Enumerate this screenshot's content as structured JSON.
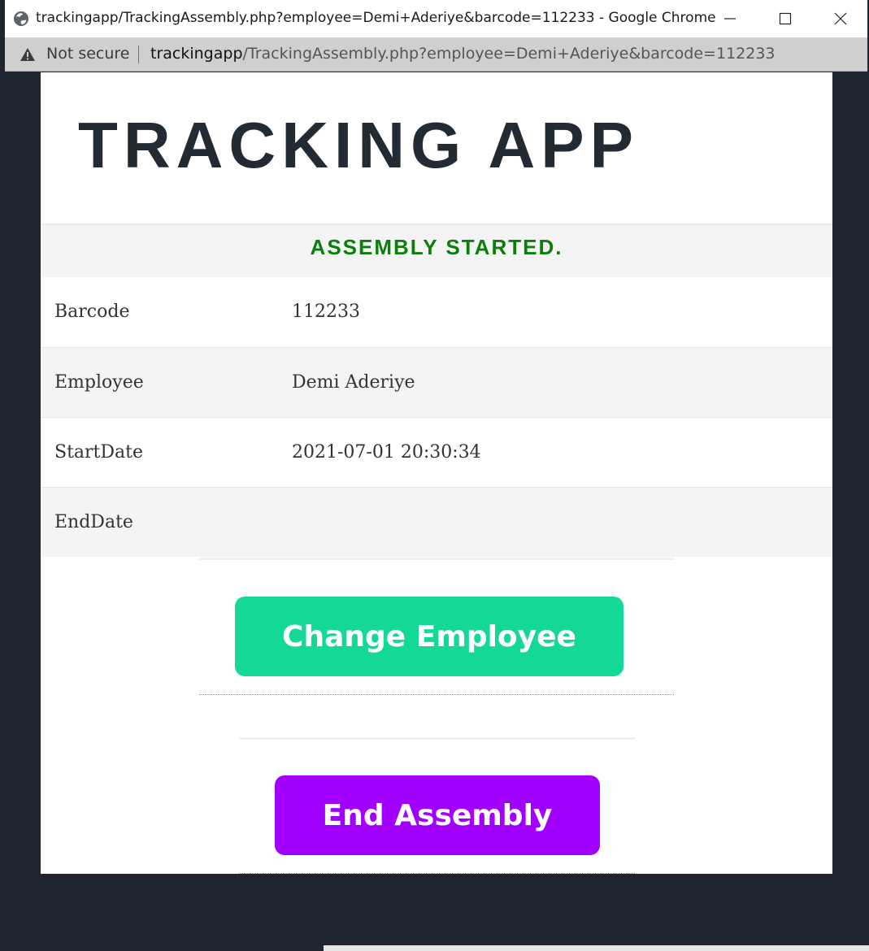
{
  "browser": {
    "window_title": "trackingapp/TrackingAssembly.php?employee=Demi+Aderiye&barcode=112233 - Google Chrome",
    "security_label": "Not secure",
    "url_host": "trackingapp",
    "url_path": "/TrackingAssembly.php?employee=Demi+Aderiye&barcode=112233"
  },
  "app": {
    "title": "TRACKING APP",
    "status_message": "ASSEMBLY STARTED.",
    "status_color": "#0a7f0a"
  },
  "details": [
    {
      "label": "Barcode",
      "value": "112233"
    },
    {
      "label": "Employee",
      "value": "Demi Aderiye"
    },
    {
      "label": "StartDate",
      "value": "2021-07-01 20:30:34"
    },
    {
      "label": "EndDate",
      "value": ""
    }
  ],
  "actions": {
    "change_employee_label": "Change Employee",
    "change_employee_color": "#14d895",
    "end_assembly_label": "End Assembly",
    "end_assembly_color": "#a100ff"
  },
  "icons": {
    "title_icon": "globe-icon",
    "security_icon": "warning-icon",
    "window_controls": [
      "minimize-icon",
      "maximize-icon",
      "close-icon"
    ]
  }
}
